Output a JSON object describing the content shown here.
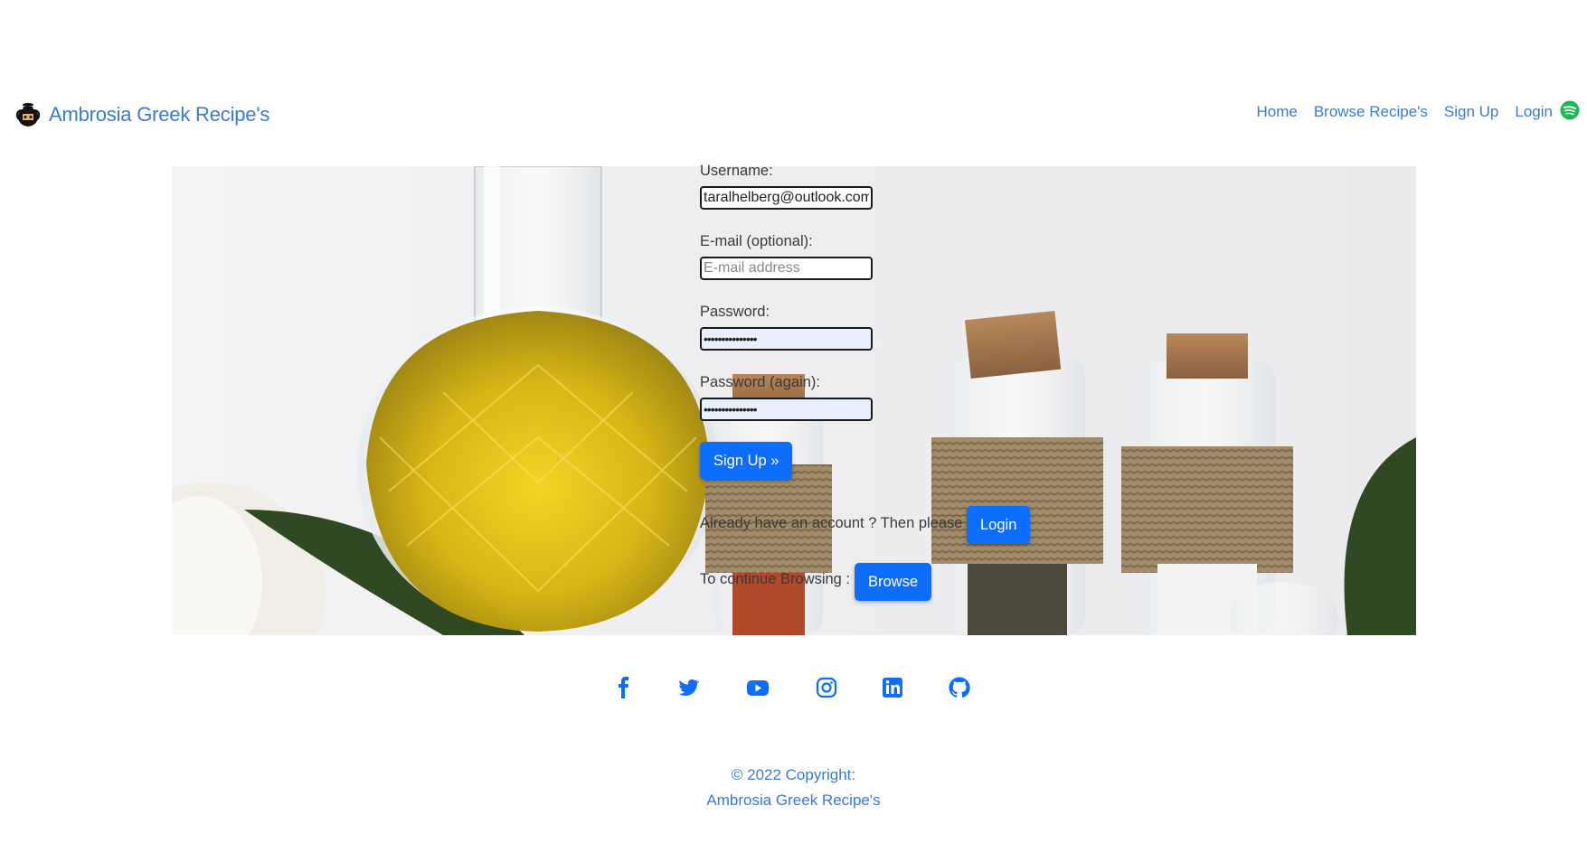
{
  "navbar": {
    "brand": "Ambrosia Greek Recipe's",
    "links": [
      "Home",
      "Browse Recipe's",
      "Sign Up",
      "Login"
    ],
    "icons": {
      "brand": "greek-amphora-icon",
      "music": "spotify-icon"
    }
  },
  "form": {
    "username_label": "Username:",
    "username_value": "taralhelberg@outlook.com",
    "email_label": "E-mail (optional):",
    "email_placeholder": "E-mail address",
    "password_label": "Password:",
    "password_value": "•••••••••••••••",
    "password_again_label": "Password (again):",
    "password_again_value": "•••••••••••••••",
    "signup_button": "Sign Up »",
    "already_text": "Already have an account ? Then please :",
    "login_button": "Login",
    "browse_text": "To continue Browsing :",
    "browse_button": "Browse"
  },
  "footer": {
    "social_icons": [
      "facebook-icon",
      "twitter-icon",
      "youtube-icon",
      "instagram-icon",
      "linkedin-icon",
      "github-icon"
    ],
    "copyright_line1": "© 2022 Copyright:",
    "copyright_line2": "Ambrosia Greek Recipe's"
  },
  "colors": {
    "link": "#3a7bd5",
    "button": "#0d6efd",
    "spotify": "#1db954"
  }
}
